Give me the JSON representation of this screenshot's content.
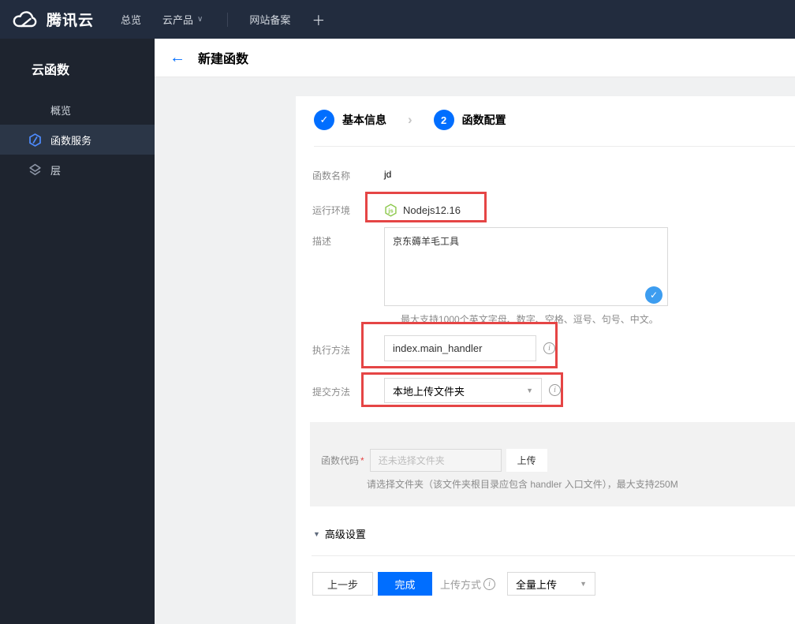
{
  "topbar": {
    "brand": "腾讯云",
    "nav_overview": "总览",
    "nav_products": "云产品",
    "nav_icp": "网站备案",
    "nav_plus": "＋"
  },
  "sidebar": {
    "title": "云函数",
    "items": [
      {
        "label": "概览",
        "icon": "grid-icon",
        "selected": false
      },
      {
        "label": "函数服务",
        "icon": "scf-hexagon-icon",
        "selected": true
      },
      {
        "label": "层",
        "icon": "layers-icon",
        "selected": false
      }
    ]
  },
  "header": {
    "title": "新建函数"
  },
  "steps": [
    {
      "num": "✓",
      "label": "基本信息",
      "state": "done"
    },
    {
      "num": "2",
      "label": "函数配置",
      "state": "active"
    }
  ],
  "form": {
    "name": {
      "label": "函数名称",
      "value": "jd"
    },
    "runtime": {
      "label": "运行环境",
      "value": "Nodejs12.16",
      "icon": "nodejs-icon"
    },
    "description": {
      "label": "描述",
      "value": "京东薅羊毛工具",
      "hint": "最大支持1000个英文字母、数字、空格、逗号、句号、中文。"
    },
    "handler": {
      "label": "执行方法",
      "value": "index.main_handler"
    },
    "submit_method": {
      "label": "提交方法",
      "value": "本地上传文件夹"
    },
    "code": {
      "label": "函数代码",
      "required_mark": "*",
      "placeholder": "还未选择文件夹",
      "upload_label": "上传",
      "hint": "请选择文件夹（该文件夹根目录应包含 handler 入口文件），最大支持250M"
    },
    "advanced_label": "高级设置"
  },
  "footer": {
    "prev_label": "上一步",
    "finish_label": "完成",
    "upload_mode_label": "上传方式",
    "upload_mode_value": "全量上传"
  },
  "icons": {
    "back_arrow": "←",
    "caret_down": "∨",
    "select_caret": "▼",
    "advanced_caret": "▼",
    "check": "✓",
    "chevron": "›",
    "info": "i",
    "node_js_text": "js"
  },
  "colors": {
    "accent_blue": "#006eff",
    "annotation_red": "#e54545",
    "node_green": "#8cc84b",
    "desc_check_blue": "#3d9df0",
    "topbar_bg": "#222c3e",
    "sidebar_bg": "#1e242f",
    "sidebar_selected_bg": "#2b3647",
    "panel_gray": "#f2f2f2"
  }
}
